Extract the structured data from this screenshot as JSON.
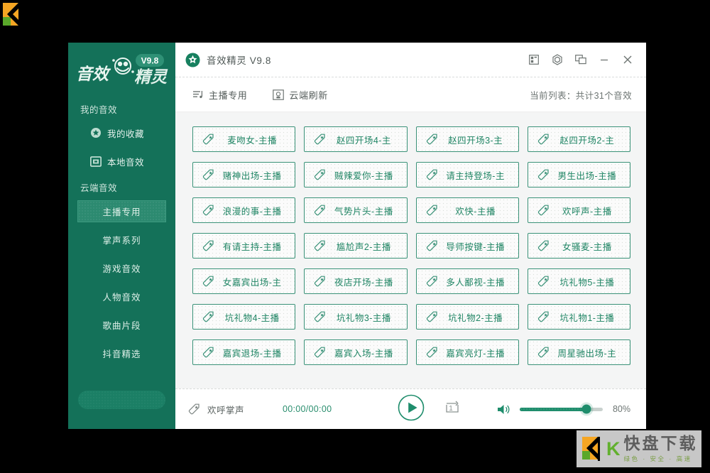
{
  "desktop": {
    "logo_icon": "k-logo-icon"
  },
  "sidebar": {
    "brand": {
      "name": "音效精灵",
      "part1": "音效",
      "part2": "精灵",
      "version_badge": "V9.8"
    },
    "group1_title": "我的音效",
    "items": [
      {
        "label": "我的收藏",
        "icon": "star-badge-icon"
      },
      {
        "label": "本地音效",
        "icon": "folder-window-icon"
      }
    ],
    "group2_title": "云端音效",
    "categories": [
      {
        "label": "主播专用",
        "active": true
      },
      {
        "label": "掌声系列",
        "active": false
      },
      {
        "label": "游戏音效",
        "active": false
      },
      {
        "label": "人物音效",
        "active": false
      },
      {
        "label": "歌曲片段",
        "active": false
      },
      {
        "label": "抖音精选",
        "active": false
      }
    ],
    "search": {
      "value": "",
      "placeholder": "",
      "icon": "search-icon"
    }
  },
  "titlebar": {
    "app_icon": "app-logo-icon",
    "title": "音效精灵 V9.8",
    "controls": [
      {
        "name": "layout-grid-icon"
      },
      {
        "name": "hexagon-settings-icon"
      },
      {
        "name": "restore-window-icon"
      },
      {
        "name": "minimize-icon"
      },
      {
        "name": "close-icon"
      }
    ]
  },
  "toolbar": {
    "anchor_button": {
      "label": "主播专用",
      "icon": "playlist-icon"
    },
    "refresh_button": {
      "label": "云端刷新",
      "icon": "cloud-refresh-icon"
    },
    "list_count": "当前列表：共计31个音效"
  },
  "grid": {
    "items": [
      "麦吻女-主播",
      "赵四开场4-主",
      "赵四开场3-主",
      "赵四开场2-主",
      "赌神出场-主播",
      "贼辣爱你-主播",
      "请主持登场-主",
      "男生出场-主播",
      "浪漫的事-主播",
      "气势片头-主播",
      "欢快-主播",
      "欢呼声-主播",
      "有请主持-主播",
      "尴尬声2-主播",
      "导师按键-主播",
      "女骚麦-主播",
      "女嘉宾出场-主",
      "夜店开场-主播",
      "多人鄙视-主播",
      "坑礼物5-主播",
      "坑礼物4-主播",
      "坑礼物3-主播",
      "坑礼物2-主播",
      "坑礼物1-主播",
      "嘉宾退场-主播",
      "嘉宾入场-主播",
      "嘉宾亮灯-主播",
      "周星驰出场-主"
    ],
    "item_icon": "sound-tag-icon"
  },
  "player": {
    "now_playing_icon": "sound-tag-icon",
    "now_playing": "欢呼掌声",
    "time": "00:00/00:00",
    "play_button": {
      "icon": "play-icon"
    },
    "loop_button": {
      "icon": "repeat-one-icon",
      "label": "1"
    },
    "volume": {
      "icon": "volume-icon",
      "percent_label": "80%",
      "percent": 80
    }
  },
  "watermark": {
    "k": "K",
    "main": "快盘下载",
    "sub": "绿色 · 安全 · 高速"
  },
  "colors": {
    "sidebar_green": "#147159",
    "accent_green": "#1f8d6c",
    "active_item": "#2c8a70",
    "content_bg": "#f4f5f5"
  }
}
